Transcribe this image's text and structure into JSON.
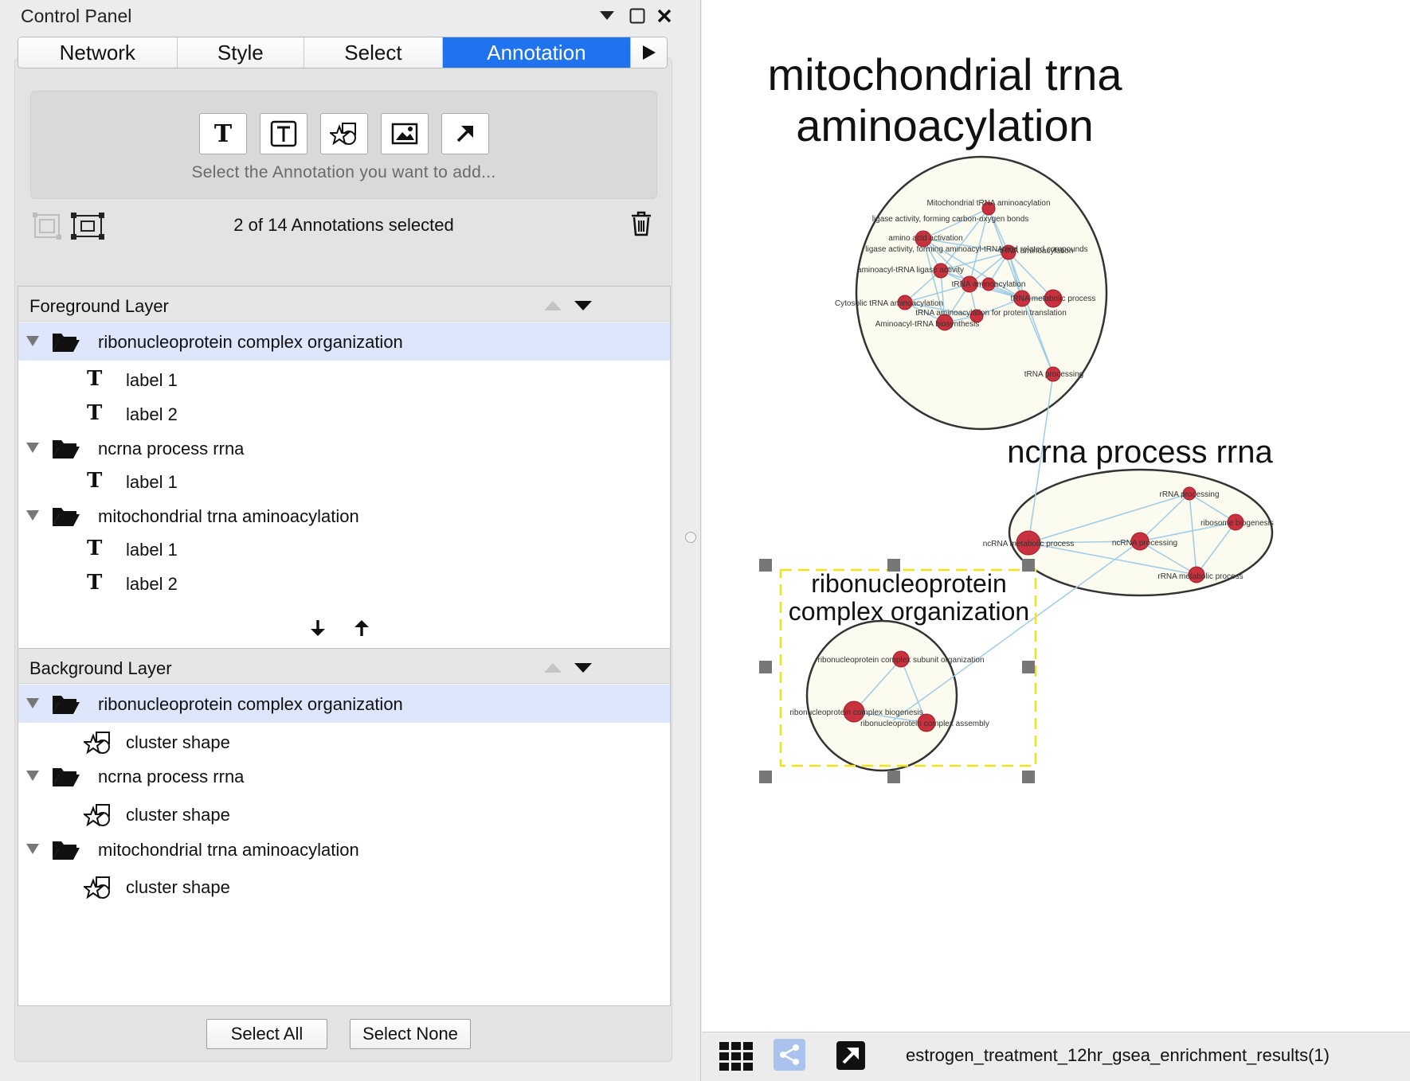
{
  "panel": {
    "title": "Control Panel",
    "tabs": [
      {
        "label": "Network"
      },
      {
        "label": "Style"
      },
      {
        "label": "Select"
      },
      {
        "label": "Annotation"
      }
    ],
    "active_tab": "Annotation"
  },
  "add_annotation": {
    "hint": "Select the Annotation you want to add...",
    "tools": [
      "text-annotation-icon",
      "bounded-text-annotation-icon",
      "shape-annotation-icon",
      "image-annotation-icon",
      "arrow-annotation-icon"
    ]
  },
  "selection": {
    "count_text": "2 of 14 Annotations selected"
  },
  "foreground": {
    "title": "Foreground Layer",
    "groups": [
      {
        "name": "ribonucleoprotein complex organization",
        "items": [
          "label 1",
          "label 2"
        ]
      },
      {
        "name": "ncrna process rrna",
        "items": [
          "label 1"
        ]
      },
      {
        "name": "mitochondrial trna aminoacylation",
        "items": [
          "label 1",
          "label 2"
        ]
      }
    ]
  },
  "background": {
    "title": "Background Layer",
    "groups": [
      {
        "name": "ribonucleoprotein complex organization",
        "items": [
          "cluster shape"
        ]
      },
      {
        "name": "ncrna process rrna",
        "items": [
          "cluster shape"
        ]
      },
      {
        "name": "mitochondrial trna aminoacylation",
        "items": [
          "cluster shape"
        ]
      }
    ]
  },
  "buttons": {
    "select_all": "Select All",
    "select_none": "Select None"
  },
  "network": {
    "clusters": [
      {
        "label_line1": "mitochondrial trna",
        "label_line2": "aminoacylation"
      },
      {
        "label_line1": "ncrna process rrna"
      },
      {
        "label_line1": "ribonucleoprotein",
        "label_line2": "complex organization"
      }
    ],
    "node_labels_mito": [
      "Mitochondrial tRNA aminoacylation",
      "ligase activity, forming carbon-oxygen bonds",
      "amino acid activation",
      "ligase activity, forming aminoacyl-tRNA and related compounds",
      "tRNA aminoacylation",
      "aminoacyl-tRNA ligase activity",
      "tRNA aminoacylation",
      "tRNA metabolic process",
      "Cytosolic tRNA aminoacylation",
      "tRNA aminoacylation for protein translation",
      "Aminoacyl-tRNA biosynthesis",
      "tRNA processing"
    ],
    "node_labels_ncrna": [
      "rRNA processing",
      "ncRNA metabolic process",
      "ncRNA processing",
      "ribosome biogenesis",
      "rRNA metabolic process"
    ],
    "node_labels_rnp": [
      "ribonucleoprotein complex subunit organization",
      "ribonucleoprotein complex biogenesis",
      "ribonucleoprotein complex assembly"
    ],
    "colors": {
      "node": "#c8323e",
      "edge": "#9fcbe6",
      "cluster_fill": "#fbfbef",
      "selection": "#f2e21a"
    }
  },
  "status": {
    "network_name": "estrogen_treatment_12hr_gsea_enrichment_results(1)"
  }
}
